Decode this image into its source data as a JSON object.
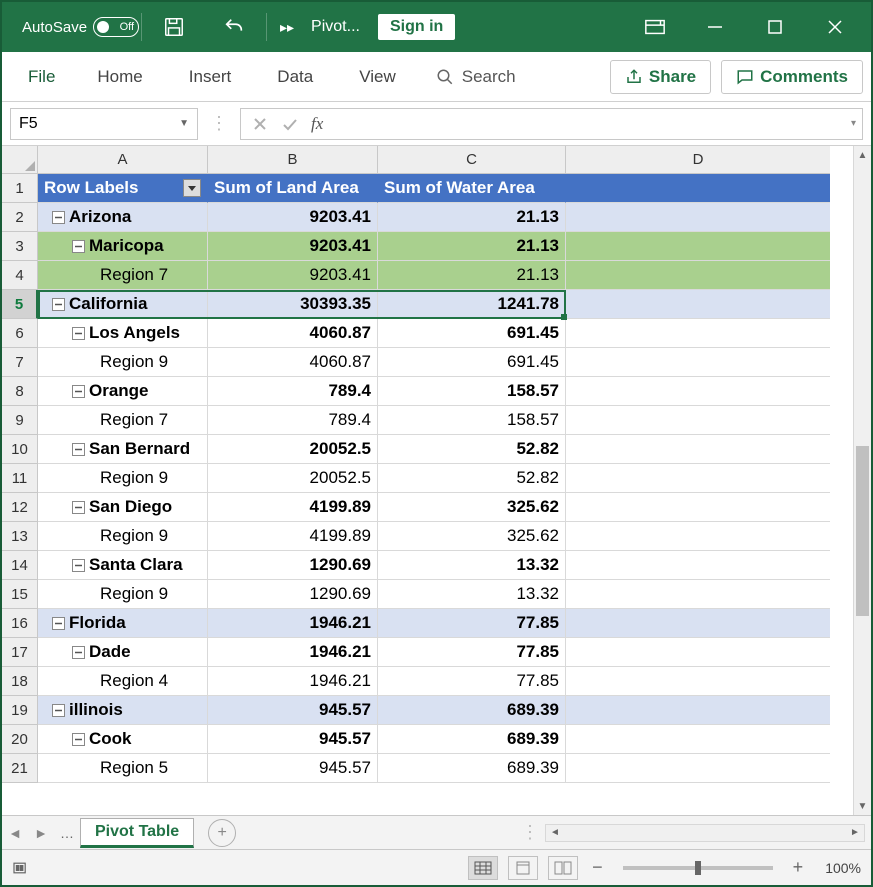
{
  "titlebar": {
    "autosave_label": "AutoSave",
    "autosave_state": "Off",
    "doc_title": "Pivot...",
    "signin": "Sign in"
  },
  "ribbon": {
    "file": "File",
    "tabs": [
      "Home",
      "Insert",
      "Data",
      "View"
    ],
    "search": "Search",
    "share": "Share",
    "comments": "Comments"
  },
  "formula": {
    "name_box": "F5",
    "fx": "fx",
    "value": ""
  },
  "columns": [
    "A",
    "B",
    "C",
    "D"
  ],
  "row_numbers": [
    "1",
    "2",
    "3",
    "4",
    "5",
    "6",
    "7",
    "8",
    "9",
    "10",
    "11",
    "12",
    "13",
    "14",
    "15",
    "16",
    "17",
    "18",
    "19",
    "20",
    "21"
  ],
  "selected_row_index": 4,
  "grid": {
    "header": {
      "a": "Row Labels",
      "b": "Sum of Land Area",
      "c": "Sum of Water Area"
    },
    "rows": [
      {
        "type": "state",
        "a": "Arizona",
        "b": "9203.41",
        "c": "21.13"
      },
      {
        "type": "county",
        "a": "Maricopa",
        "b": "9203.41",
        "c": "21.13",
        "green": true
      },
      {
        "type": "region",
        "a": "Region 7",
        "b": "9203.41",
        "c": "21.13",
        "green": true
      },
      {
        "type": "state",
        "a": "California",
        "b": "30393.35",
        "c": "1241.78"
      },
      {
        "type": "county",
        "a": "Los Angels",
        "b": "4060.87",
        "c": "691.45"
      },
      {
        "type": "region",
        "a": "Region 9",
        "b": "4060.87",
        "c": "691.45"
      },
      {
        "type": "county",
        "a": "Orange",
        "b": "789.4",
        "c": "158.57"
      },
      {
        "type": "region",
        "a": "Region 7",
        "b": "789.4",
        "c": "158.57"
      },
      {
        "type": "county",
        "a": "San Bernard",
        "b": "20052.5",
        "c": "52.82"
      },
      {
        "type": "region",
        "a": "Region 9",
        "b": "20052.5",
        "c": "52.82"
      },
      {
        "type": "county",
        "a": "San Diego",
        "b": "4199.89",
        "c": "325.62"
      },
      {
        "type": "region",
        "a": "Region 9",
        "b": "4199.89",
        "c": "325.62"
      },
      {
        "type": "county",
        "a": "Santa Clara",
        "b": "1290.69",
        "c": "13.32"
      },
      {
        "type": "region",
        "a": "Region 9",
        "b": "1290.69",
        "c": "13.32"
      },
      {
        "type": "state",
        "a": "Florida",
        "b": "1946.21",
        "c": "77.85"
      },
      {
        "type": "county",
        "a": "Dade",
        "b": "1946.21",
        "c": "77.85"
      },
      {
        "type": "region",
        "a": "Region 4",
        "b": "1946.21",
        "c": "77.85"
      },
      {
        "type": "state",
        "a": "illinois",
        "b": "945.57",
        "c": "689.39"
      },
      {
        "type": "county",
        "a": "Cook",
        "b": "945.57",
        "c": "689.39"
      },
      {
        "type": "region",
        "a": "Region 5",
        "b": "945.57",
        "c": "689.39"
      }
    ]
  },
  "sheet": {
    "active": "Pivot Table"
  },
  "status": {
    "zoom": "100%"
  }
}
